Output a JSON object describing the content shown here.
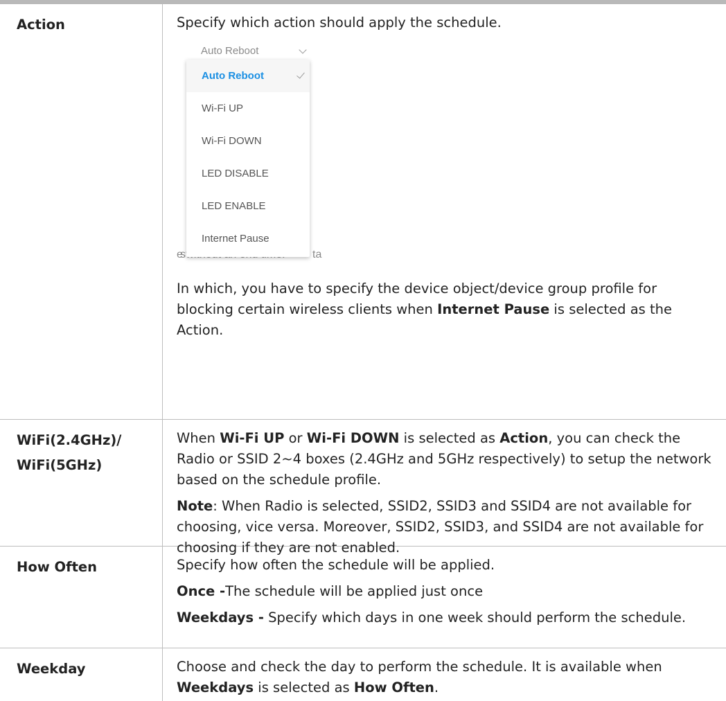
{
  "rows": [
    {
      "label": "Action",
      "desc_intro": "Specify which action should apply the schedule.",
      "dropdown": {
        "selected_value": "Auto Reboot",
        "options": [
          "Auto Reboot",
          "Wi-Fi UP",
          "Wi-Fi DOWN",
          "LED DISABLE",
          "LED ENABLE",
          "Internet Pause"
        ],
        "bg_fragment_1": "sd",
        "bg_fragment_2": "s",
        "bg_fragment_3": "ta",
        "bg_fragment_under": "e without an end time."
      },
      "desc_after": {
        "p1": "In which, you have to specify the device object/device group profile for blocking certain wireless clients when ",
        "b1": "Internet Pause",
        "p2": " is selected as the Action."
      }
    },
    {
      "label_line1": "WiFi(2.4GHz)/",
      "label_line2": "WiFi(5GHz)",
      "para1": {
        "t1": "When ",
        "b1": "Wi-Fi UP",
        "t2": " or ",
        "b2": "Wi-Fi DOWN",
        "t3": " is selected as ",
        "b3": "Action",
        "t4": ", you can check the Radio or SSID 2~4 boxes (2.4GHz and 5GHz respectively) to setup the network based on the schedule profile."
      },
      "para2": {
        "b1": "Note",
        "t1": ": When Radio is selected, SSID2, SSID3 and SSID4 are not available for choosing, vice versa. Moreover, SSID2, SSID3, and SSID4 are not available for choosing if they are not enabled."
      }
    },
    {
      "label": "How Often",
      "para1": "Specify how often the schedule will be applied.",
      "para2": {
        "b1": "Once -",
        "t1": "The schedule will be applied just once"
      },
      "para3": {
        "b1": "Weekdays -",
        "t1": " Specify which days in one week should perform the schedule."
      }
    },
    {
      "label": "Weekday",
      "para1": {
        "t1": "Choose and check the day to perform the schedule. It is available when ",
        "b1": "Weekdays",
        "t2": " is selected as ",
        "b2": "How Often",
        "t3": "."
      }
    }
  ]
}
